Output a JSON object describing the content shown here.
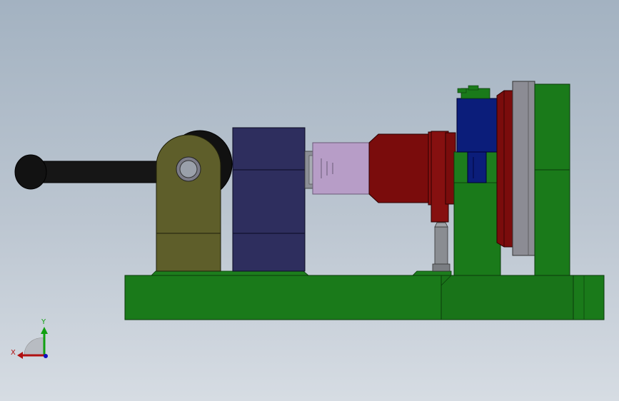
{
  "viewport": {
    "background_top": "#a3b2c1",
    "background_bottom": "#d6dce3"
  },
  "model": {
    "colors": {
      "base_green": "#1a7a1a",
      "base_green_dark": "#0f5a0f",
      "handle_black": "#151515",
      "clamp_olive": "#5f5f2a",
      "block_navy": "#2e2e5e",
      "sleeve_lavender": "#b79dc7",
      "nut_red": "#7a0c0c",
      "motor_blue": "#0b1d7a",
      "disc_gray": "#8c8c94",
      "pin_gray": "#8a8d92"
    }
  },
  "triad": {
    "x_label": "X",
    "y_label": "Y",
    "x_color": "#b01010",
    "y_color": "#10a010",
    "z_color": "#1010c0"
  }
}
